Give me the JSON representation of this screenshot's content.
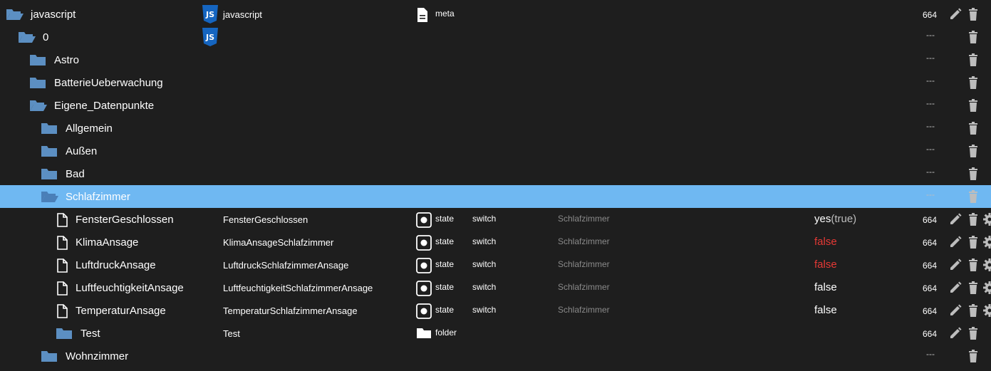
{
  "colors": {
    "background": "#1e1e1e",
    "selected_row": "#6fb8f2",
    "folder_icon": "#5c8fc2",
    "js_icon": "#1565c0",
    "false_red": "#e53935",
    "muted_text": "#8a8a8a"
  },
  "rows": [
    {
      "level": 0,
      "icon": "folder-open-icon",
      "name": "javascript",
      "objname": "javascript",
      "type_icon": "file-icon",
      "type": "meta",
      "role": "",
      "room": "",
      "value": "",
      "value_sub": "",
      "value_color": "normal",
      "acl": "664",
      "dash": "",
      "actions": [
        "edit",
        "delete"
      ],
      "selected": false
    },
    {
      "level": 1,
      "icon": "folder-open-icon",
      "name": "0",
      "objname": "",
      "type_icon": "",
      "type": "",
      "role": "",
      "room": "",
      "value": "",
      "value_sub": "",
      "value_color": "normal",
      "acl": "",
      "dash": "---",
      "actions": [
        "delete"
      ],
      "selected": false
    },
    {
      "level": 2,
      "icon": "folder-icon",
      "name": "Astro",
      "objname": "",
      "type_icon": "",
      "type": "",
      "role": "",
      "room": "",
      "value": "",
      "value_sub": "",
      "value_color": "normal",
      "acl": "",
      "dash": "---",
      "actions": [
        "delete"
      ],
      "selected": false
    },
    {
      "level": 2,
      "icon": "folder-icon",
      "name": "BatterieUeberwachung",
      "objname": "",
      "type_icon": "",
      "type": "",
      "role": "",
      "room": "",
      "value": "",
      "value_sub": "",
      "value_color": "normal",
      "acl": "",
      "dash": "---",
      "actions": [
        "delete"
      ],
      "selected": false
    },
    {
      "level": 2,
      "icon": "folder-open-icon",
      "name": "Eigene_Datenpunkte",
      "objname": "",
      "type_icon": "",
      "type": "",
      "role": "",
      "room": "",
      "value": "",
      "value_sub": "",
      "value_color": "normal",
      "acl": "",
      "dash": "---",
      "actions": [
        "delete"
      ],
      "selected": false
    },
    {
      "level": 3,
      "icon": "folder-icon",
      "name": "Allgemein",
      "objname": "",
      "type_icon": "",
      "type": "",
      "role": "",
      "room": "",
      "value": "",
      "value_sub": "",
      "value_color": "normal",
      "acl": "",
      "dash": "---",
      "actions": [
        "delete"
      ],
      "selected": false
    },
    {
      "level": 3,
      "icon": "folder-icon",
      "name": "Außen",
      "objname": "",
      "type_icon": "",
      "type": "",
      "role": "",
      "room": "",
      "value": "",
      "value_sub": "",
      "value_color": "normal",
      "acl": "",
      "dash": "---",
      "actions": [
        "delete"
      ],
      "selected": false
    },
    {
      "level": 3,
      "icon": "folder-icon",
      "name": "Bad",
      "objname": "",
      "type_icon": "",
      "type": "",
      "role": "",
      "room": "",
      "value": "",
      "value_sub": "",
      "value_color": "normal",
      "acl": "",
      "dash": "---",
      "actions": [
        "delete"
      ],
      "selected": false
    },
    {
      "level": 3,
      "icon": "folder-open-icon",
      "name": "Schlafzimmer",
      "objname": "",
      "type_icon": "",
      "type": "",
      "role": "",
      "room": "",
      "value": "",
      "value_sub": "",
      "value_color": "normal",
      "acl": "",
      "dash": "---",
      "actions": [
        "delete"
      ],
      "selected": true
    },
    {
      "level": 4,
      "icon": "file-icon",
      "name": "FensterGeschlossen",
      "objname": "FensterGeschlossen",
      "type_icon": "state-icon",
      "type": "state",
      "role": "switch",
      "room": "Schlafzimmer",
      "value": "yes",
      "value_sub": "(true)",
      "value_color": "normal",
      "acl": "664",
      "dash": "",
      "actions": [
        "edit",
        "delete",
        "settings"
      ],
      "selected": false
    },
    {
      "level": 4,
      "icon": "file-icon",
      "name": "KlimaAnsage",
      "objname": "KlimaAnsageSchlafzimmer",
      "type_icon": "state-icon",
      "type": "state",
      "role": "switch",
      "room": "Schlafzimmer",
      "value": "false",
      "value_sub": "",
      "value_color": "red",
      "acl": "664",
      "dash": "",
      "actions": [
        "edit",
        "delete",
        "settings"
      ],
      "selected": false
    },
    {
      "level": 4,
      "icon": "file-icon",
      "name": "LuftdruckAnsage",
      "objname": "LuftdruckSchlafzimmerAnsage",
      "type_icon": "state-icon",
      "type": "state",
      "role": "switch",
      "room": "Schlafzimmer",
      "value": "false",
      "value_sub": "",
      "value_color": "red",
      "acl": "664",
      "dash": "",
      "actions": [
        "edit",
        "delete",
        "settings"
      ],
      "selected": false
    },
    {
      "level": 4,
      "icon": "file-icon",
      "name": "LuftfeuchtigkeitAnsage",
      "objname": "LuftfeuchtigkeitSchlafzimmerAnsage",
      "type_icon": "state-icon",
      "type": "state",
      "role": "switch",
      "room": "Schlafzimmer",
      "value": "false",
      "value_sub": "",
      "value_color": "normal",
      "acl": "664",
      "dash": "",
      "actions": [
        "edit",
        "delete",
        "settings"
      ],
      "selected": false
    },
    {
      "level": 4,
      "icon": "file-icon",
      "name": "TemperaturAnsage",
      "objname": "TemperaturSchlafzimmerAnsage",
      "type_icon": "state-icon",
      "type": "state",
      "role": "switch",
      "room": "Schlafzimmer",
      "value": "false",
      "value_sub": "",
      "value_color": "normal",
      "acl": "664",
      "dash": "",
      "actions": [
        "edit",
        "delete",
        "settings"
      ],
      "selected": false
    },
    {
      "level": 4,
      "icon": "folder-icon",
      "name": "Test",
      "objname": "Test",
      "type_icon": "folder-icon",
      "type": "folder",
      "role": "",
      "room": "",
      "value": "",
      "value_sub": "",
      "value_color": "normal",
      "acl": "664",
      "dash": "",
      "actions": [
        "edit",
        "delete"
      ],
      "selected": false
    },
    {
      "level": 3,
      "icon": "folder-icon",
      "name": "Wohnzimmer",
      "objname": "",
      "type_icon": "",
      "type": "",
      "role": "",
      "room": "",
      "value": "",
      "value_sub": "",
      "value_color": "normal",
      "acl": "",
      "dash": "---",
      "actions": [
        "delete"
      ],
      "selected": false
    }
  ]
}
